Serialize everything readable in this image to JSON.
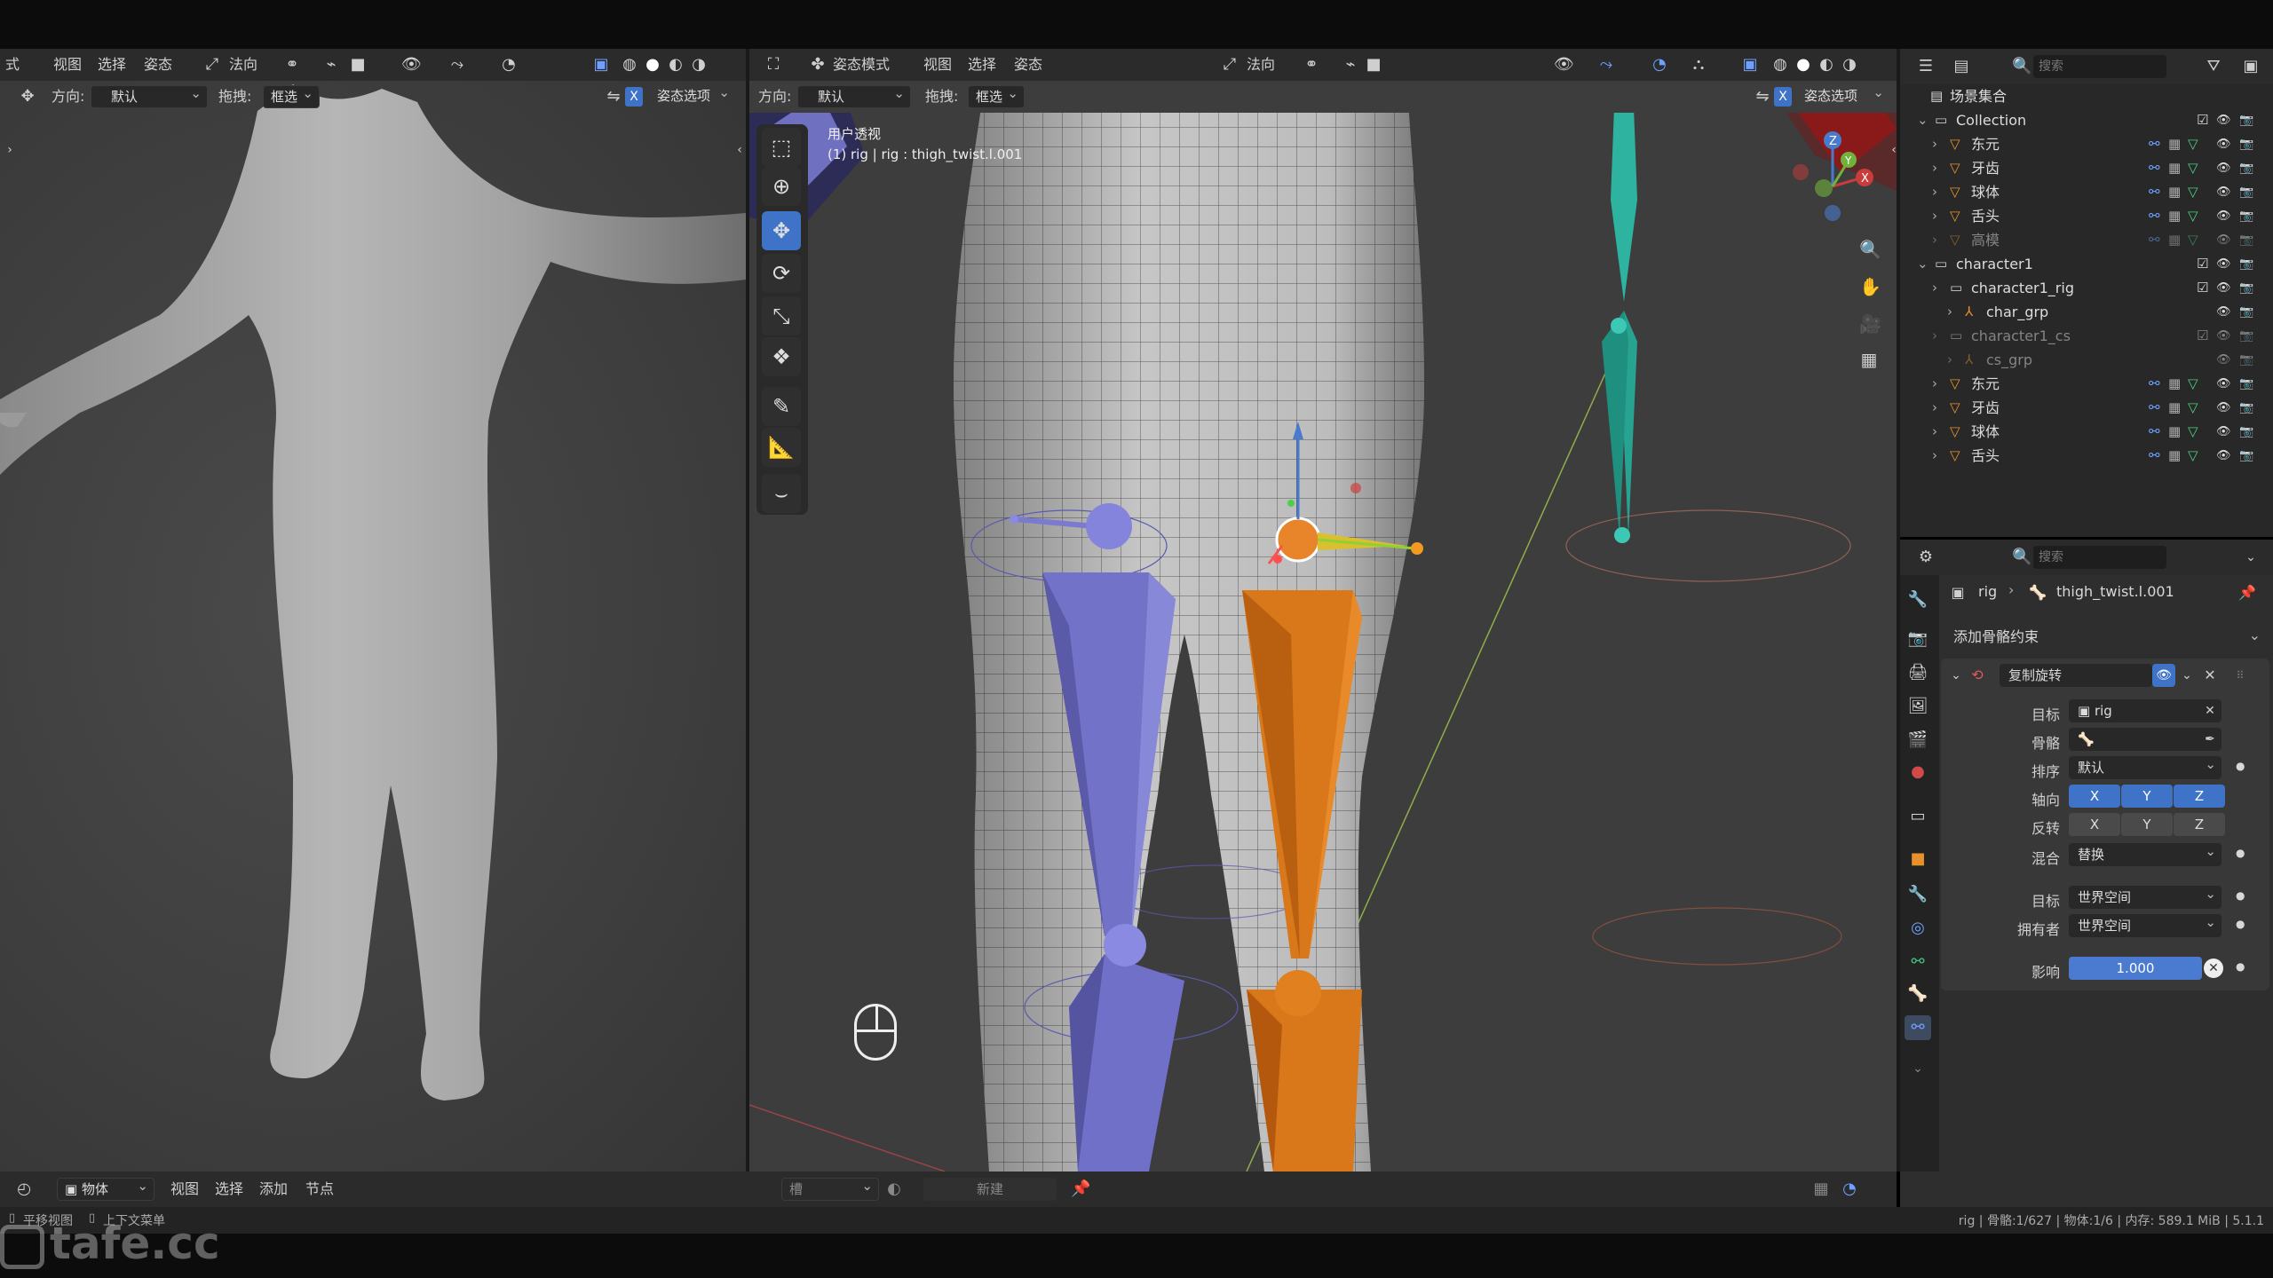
{
  "left_header": {
    "items": [
      "式",
      "视图",
      "选择",
      "姿态"
    ],
    "mode": "法向"
  },
  "left_toolbar": {
    "orient_label": "方向:",
    "orient_value": "默认",
    "drag_label": "拖拽:",
    "drag_value": "框选",
    "pose_options": "姿态选项"
  },
  "main_header": {
    "mode": "姿态模式",
    "menu": [
      "视图",
      "选择",
      "姿态"
    ],
    "normal": "法向"
  },
  "main_toolbar": {
    "orient_label": "方向:",
    "orient_value": "默认",
    "drag_label": "拖拽:",
    "drag_value": "框选",
    "pose_options": "姿态选项",
    "x_toggle": "X"
  },
  "viewport": {
    "view_name": "用户透视",
    "view_info": "(1) rig | rig : thigh_twist.l.001"
  },
  "outliner": {
    "search_placeholder": "搜索",
    "root": "场景集合",
    "rows": [
      {
        "label": "Collection",
        "depth": 1,
        "kind": "collection"
      },
      {
        "label": "东元",
        "depth": 2,
        "kind": "mesh"
      },
      {
        "label": "牙齿",
        "depth": 2,
        "kind": "mesh"
      },
      {
        "label": "球体",
        "depth": 2,
        "kind": "mesh"
      },
      {
        "label": "舌头",
        "depth": 2,
        "kind": "mesh"
      },
      {
        "label": "高模",
        "depth": 2,
        "kind": "mesh-dim"
      },
      {
        "label": "character1",
        "depth": 1,
        "kind": "collection"
      },
      {
        "label": "character1_rig",
        "depth": 2,
        "kind": "collection"
      },
      {
        "label": "char_grp",
        "depth": 3,
        "kind": "armature"
      },
      {
        "label": "character1_cs",
        "depth": 2,
        "kind": "collection-dim"
      },
      {
        "label": "cs_grp",
        "depth": 3,
        "kind": "armature-dim"
      },
      {
        "label": "东元",
        "depth": 2,
        "kind": "mesh"
      },
      {
        "label": "牙齿",
        "depth": 2,
        "kind": "mesh"
      },
      {
        "label": "球体",
        "depth": 2,
        "kind": "mesh"
      },
      {
        "label": "舌头",
        "depth": 2,
        "kind": "mesh"
      }
    ]
  },
  "properties": {
    "search_placeholder": "搜索",
    "breadcrumb": {
      "object": "rig",
      "bone": "thigh_twist.l.001"
    },
    "add_constraint": "添加骨骼约束",
    "constraint_name": "复制旋转",
    "target_label": "目标",
    "target_value": "rig",
    "bone_label": "骨骼",
    "order_label": "排序",
    "order_value": "默认",
    "axis_label": "轴向",
    "invert_label": "反转",
    "axes": [
      "X",
      "Y",
      "Z"
    ],
    "mix_label": "混合",
    "mix_value": "替换",
    "target_space_label": "目标",
    "target_space_value": "世界空间",
    "owner_label": "拥有者",
    "owner_value": "世界空间",
    "influence_label": "影响",
    "influence_value": "1.000"
  },
  "bottom_header": {
    "editor": "物体",
    "menu": [
      "视图",
      "选择",
      "添加",
      "节点"
    ],
    "slot": "槽",
    "new_button": "新建"
  },
  "status_bar": {
    "left_hint1": "平移视图",
    "left_hint2": "上下文菜单",
    "right": "rig | 骨骼:1/627 | 物体:1/6 | 内存: 589.1 MiB | 5.1.1"
  },
  "watermark": "tafe.cc"
}
